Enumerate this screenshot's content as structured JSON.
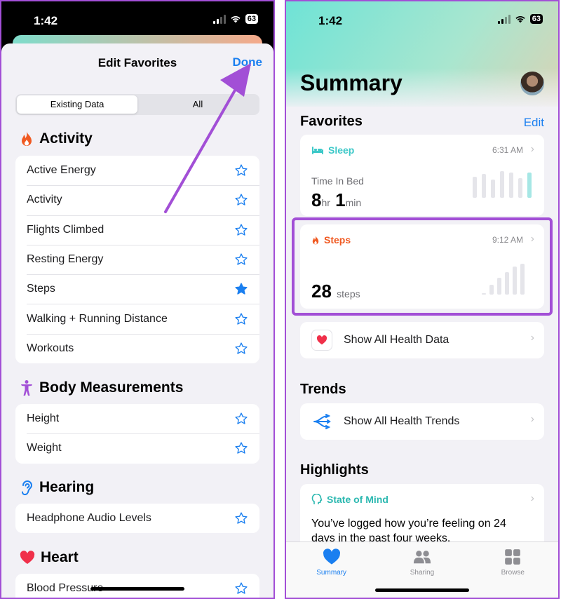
{
  "status": {
    "time": "1:42",
    "battery": "63"
  },
  "left": {
    "title": "Edit Favorites",
    "done": "Done",
    "segments": [
      "Existing Data",
      "All"
    ],
    "sections": [
      {
        "name": "Activity",
        "icon": "flame-icon",
        "items": [
          {
            "label": "Active Energy",
            "favorite": false
          },
          {
            "label": "Activity",
            "favorite": false
          },
          {
            "label": "Flights Climbed",
            "favorite": false
          },
          {
            "label": "Resting Energy",
            "favorite": false
          },
          {
            "label": "Steps",
            "favorite": true
          },
          {
            "label": "Walking + Running Distance",
            "favorite": false
          },
          {
            "label": "Workouts",
            "favorite": false
          }
        ]
      },
      {
        "name": "Body Measurements",
        "icon": "figure-icon",
        "items": [
          {
            "label": "Height",
            "favorite": false
          },
          {
            "label": "Weight",
            "favorite": false
          }
        ]
      },
      {
        "name": "Hearing",
        "icon": "ear-icon",
        "items": [
          {
            "label": "Headphone Audio Levels",
            "favorite": false
          }
        ]
      },
      {
        "name": "Heart",
        "icon": "heart-icon",
        "items": [
          {
            "label": "Blood Pressure",
            "favorite": false
          }
        ]
      }
    ]
  },
  "right": {
    "title": "Summary",
    "favorites_label": "Favorites",
    "edit": "Edit",
    "sleep": {
      "title": "Sleep",
      "time": "6:31 AM",
      "metric": "Time In Bed",
      "hr": "8",
      "hr_unit": "hr",
      "min": "1",
      "min_unit": "min"
    },
    "steps": {
      "title": "Steps",
      "time": "9:12 AM",
      "value": "28",
      "unit": "steps"
    },
    "show_all_data": "Show All Health Data",
    "trends_label": "Trends",
    "show_all_trends": "Show All Health Trends",
    "highlights_label": "Highlights",
    "highlight": {
      "title": "State of Mind",
      "text": "You’ve logged how you’re feeling on 24 days in the past four weeks."
    },
    "tabs": [
      "Summary",
      "Sharing",
      "Browse"
    ]
  },
  "colors": {
    "accent": "#1a7ff0",
    "activity": "#f05a22",
    "body": "#a24fd6",
    "hearing": "#1a7ff0",
    "heart": "#f0304a",
    "sleep": "#3cc8c8",
    "annotation": "#a24fd6"
  }
}
